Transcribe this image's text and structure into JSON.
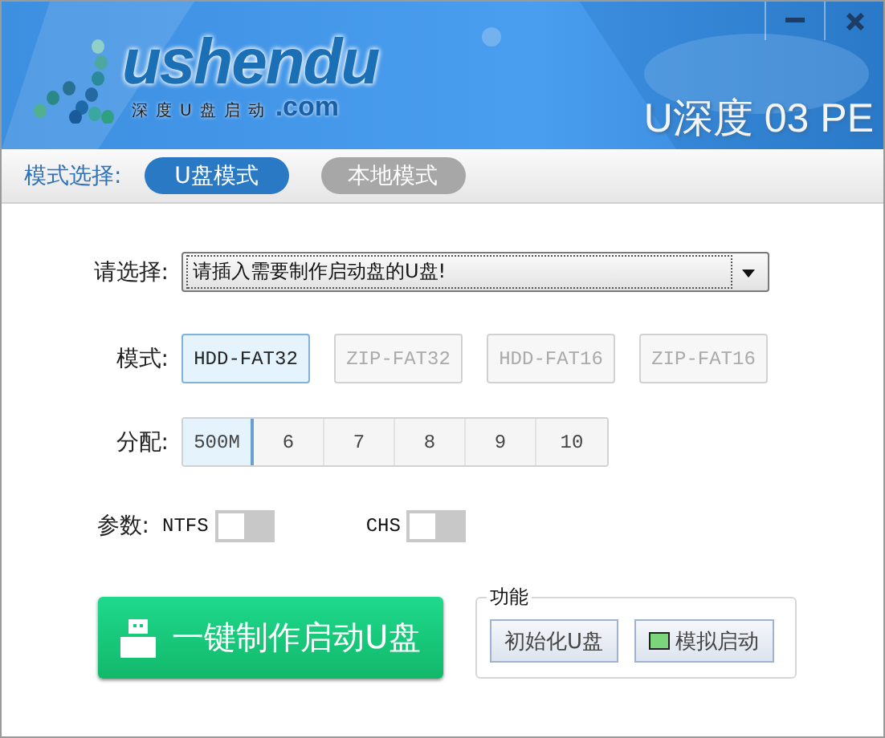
{
  "window": {
    "title": "U深度 03 PE"
  },
  "logo": {
    "wordmark": "ushendu",
    "tagline": "深度U盘启动",
    "domain": ".com"
  },
  "mode_bar": {
    "label": "模式选择:",
    "tabs": [
      {
        "label": "U盘模式",
        "selected": true
      },
      {
        "label": "本地模式",
        "selected": false
      }
    ]
  },
  "device": {
    "label": "请选择:",
    "value": "请插入需要制作启动盘的U盘!"
  },
  "modes": {
    "label": "模式:",
    "options": [
      {
        "label": "HDD-FAT32",
        "selected": true
      },
      {
        "label": "ZIP-FAT32",
        "selected": false
      },
      {
        "label": "HDD-FAT16",
        "selected": false
      },
      {
        "label": "ZIP-FAT16",
        "selected": false
      }
    ]
  },
  "allocation": {
    "label": "分配:",
    "options": [
      {
        "label": "500M",
        "selected": true
      },
      {
        "label": "6",
        "selected": false
      },
      {
        "label": "7",
        "selected": false
      },
      {
        "label": "8",
        "selected": false
      },
      {
        "label": "9",
        "selected": false
      },
      {
        "label": "10",
        "selected": false
      }
    ]
  },
  "params": {
    "label": "参数:",
    "switches": [
      {
        "label": "NTFS",
        "on": false
      },
      {
        "label": "CHS",
        "on": false
      }
    ]
  },
  "make_button": "一键制作启动U盘",
  "functions": {
    "title": "功能",
    "buttons": [
      {
        "label": "初始化U盘",
        "kind": "plain"
      },
      {
        "label": "模拟启动",
        "kind": "monitor"
      }
    ]
  }
}
